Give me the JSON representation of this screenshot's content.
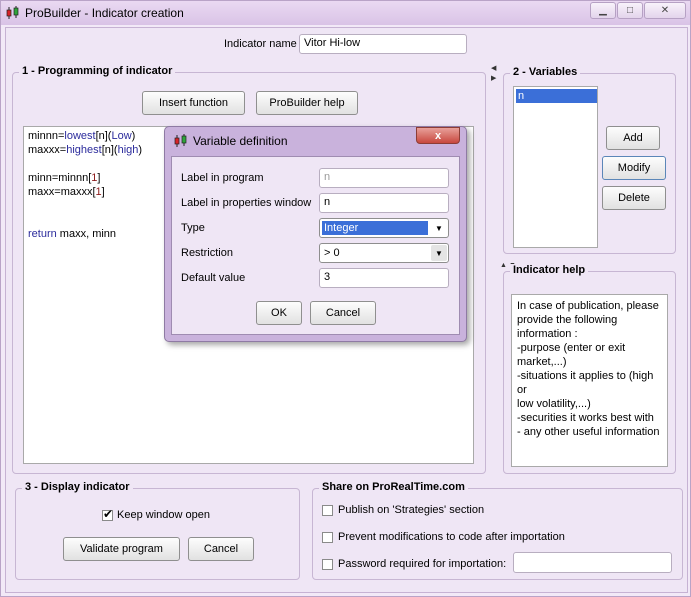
{
  "window": {
    "title": "ProBuilder - Indicator creation",
    "caption_buttons": [
      "▁",
      "□",
      "✕"
    ]
  },
  "indicator_name": {
    "label": "Indicator name",
    "value": "Vitor Hi-low"
  },
  "programming": {
    "title": "1 - Programming of indicator",
    "insert_function": "Insert function",
    "probuilder_help": "ProBuilder help",
    "code": {
      "l1a": "minnn=",
      "l1b": "lowest",
      "l1c": "[n](",
      "l1d": "Low",
      "l1e": ")",
      "l2a": "maxxx=",
      "l2b": "highest",
      "l2c": "[n](",
      "l2d": "high",
      "l2e": ")",
      "l3a": "minn=minnn[",
      "l3b": "1",
      "l3c": "]",
      "l4a": "maxx=maxxx[",
      "l4b": "1",
      "l4c": "]",
      "l5a": "return",
      "l5b": " maxx, minn"
    }
  },
  "variables": {
    "title": "2 - Variables",
    "items": [
      "n"
    ],
    "add": "Add",
    "modify": "Modify",
    "delete": "Delete"
  },
  "indicator_help": {
    "title": "Indicator help",
    "lines": [
      "In case of publication, please",
      "provide the following",
      "information :",
      "-purpose (enter or exit",
      "market,...)",
      "-situations it applies to (high or",
      "low volatility,...)",
      "-securities it works best with",
      "- any other useful information"
    ]
  },
  "display": {
    "title": "3 - Display indicator",
    "keep_window_open": "Keep window open",
    "validate": "Validate program",
    "cancel": "Cancel"
  },
  "share": {
    "title": "Share on ProRealTime.com",
    "publish": "Publish on 'Strategies' section",
    "prevent": "Prevent modifications to code after importation",
    "password": "Password required for importation:"
  },
  "dialog": {
    "title": "Variable definition",
    "close": "x",
    "label_in_program": "Label in program",
    "label_in_program_value": "n",
    "label_in_properties": "Label in properties window",
    "label_in_properties_value": "n",
    "type_label": "Type",
    "type_value": "Integer",
    "restriction_label": "Restriction",
    "restriction_value": "> 0",
    "default_label": "Default value",
    "default_value": "3",
    "ok": "OK",
    "cancel": "Cancel"
  },
  "colors": {
    "window_bg": "#efe6f5",
    "selection": "#3b6fd8",
    "dialog_frame": "#c9b2dc",
    "close_red": "#c8483e"
  }
}
